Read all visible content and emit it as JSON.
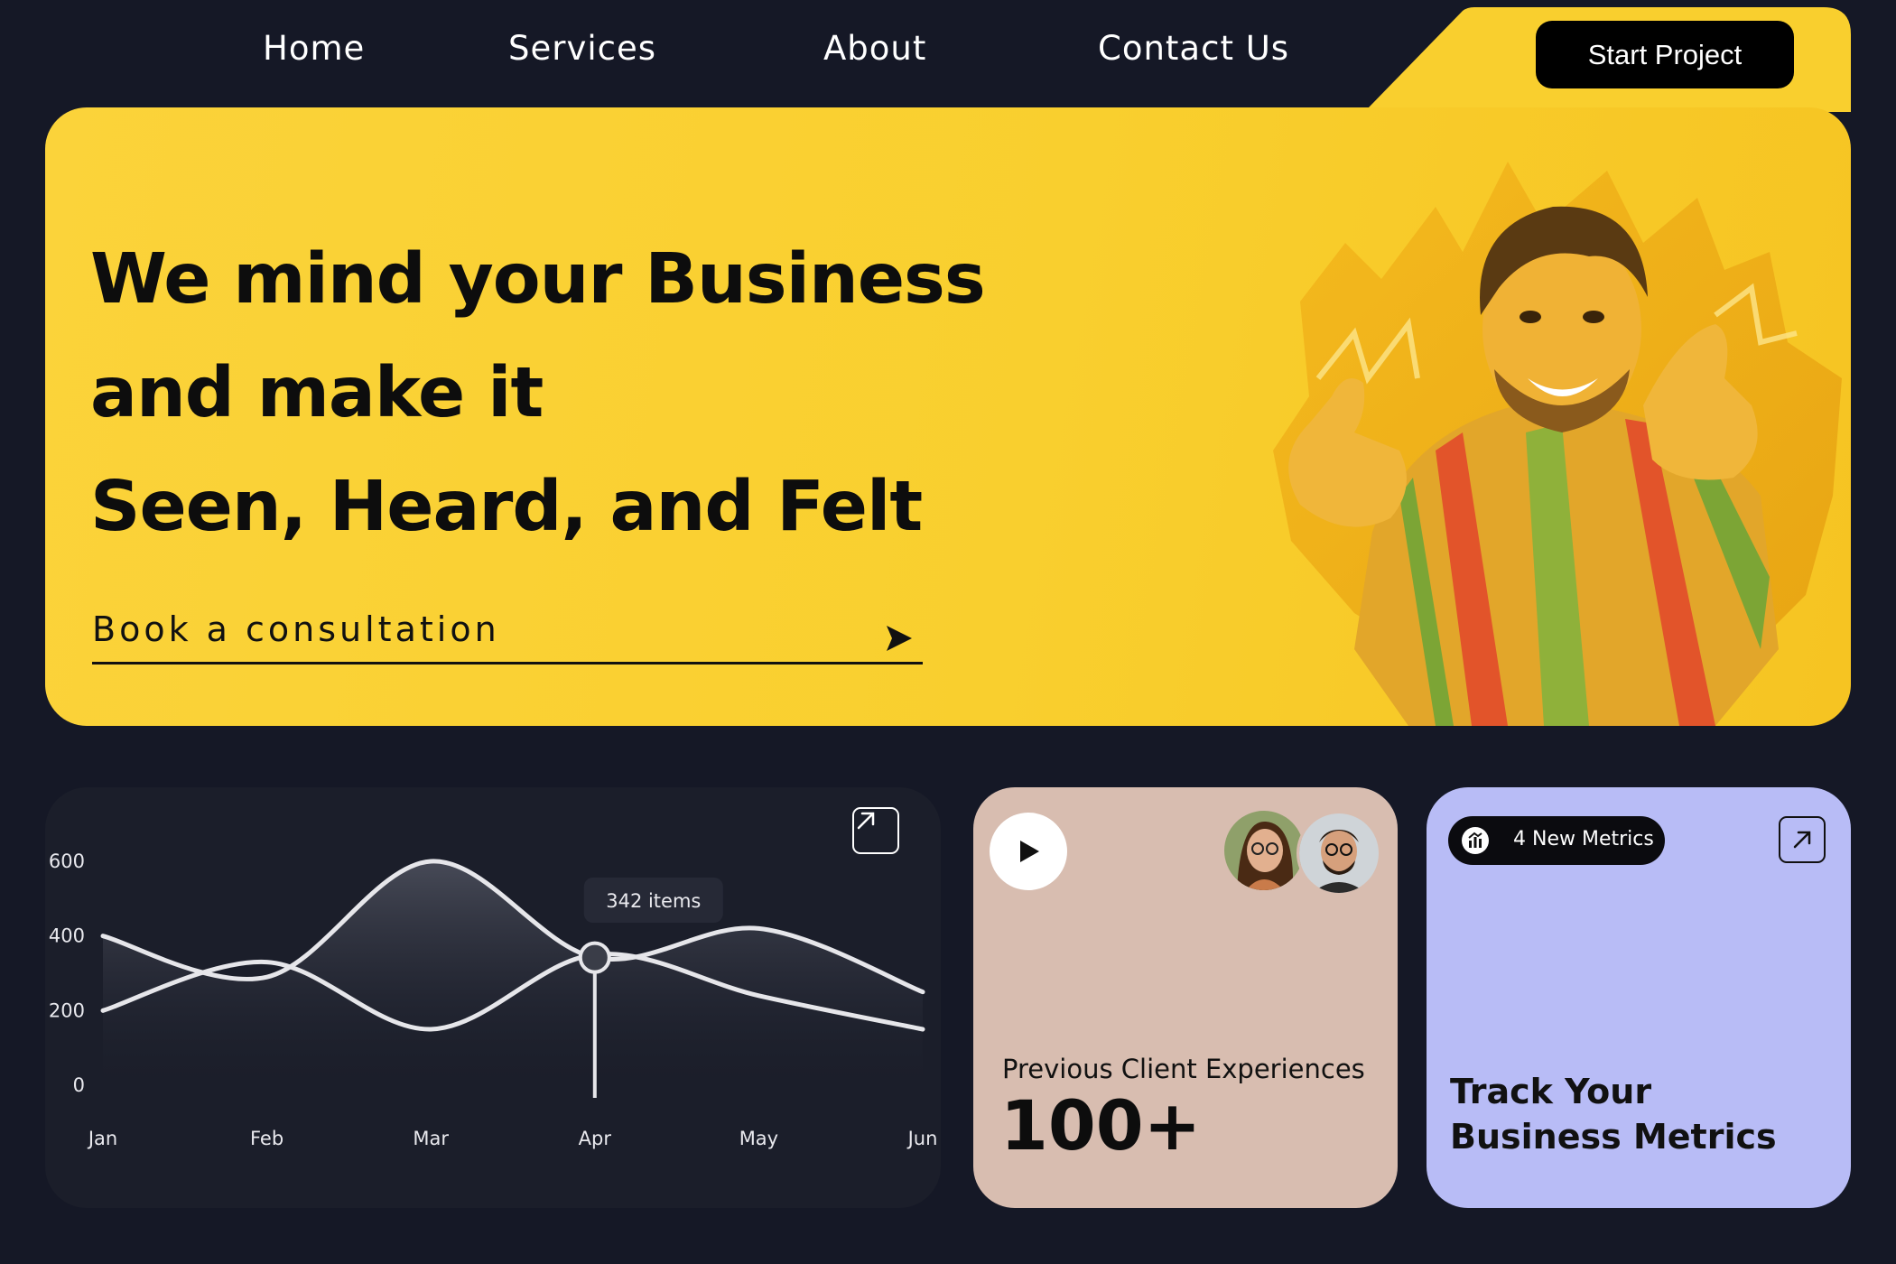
{
  "nav": {
    "links": [
      "Home",
      "Services",
      "About",
      "Contact Us"
    ],
    "cta_label": "Start Project"
  },
  "hero": {
    "title_lines": [
      "We mind your Business",
      "and make it",
      "Seen, Heard, and Felt"
    ],
    "cta_label": "Book a consultation"
  },
  "chart": {
    "tooltip": "342 items"
  },
  "chart_data": {
    "type": "line",
    "x": [
      "Jan",
      "Feb",
      "Mar",
      "Apr",
      "May",
      "Jun"
    ],
    "ylim": [
      0,
      600
    ],
    "yticks": [
      0,
      200,
      400,
      600
    ],
    "series": [
      {
        "values": [
          400,
          290,
          600,
          342,
          420,
          250
        ]
      },
      {
        "values": [
          200,
          330,
          150,
          350,
          240,
          150
        ]
      }
    ],
    "highlight": {
      "x": "Apr",
      "value": 342,
      "label": "342 items"
    },
    "grid": false
  },
  "client_card": {
    "label": "Previous Client Experiences",
    "count": "100+"
  },
  "metrics_card": {
    "badge": "4 New Metrics",
    "title": "Track Your Business Metrics"
  },
  "colors": {
    "background": "#151826",
    "hero": "#f9cf2e",
    "chart_card": "#1b1e2a",
    "client_card": "#d8bdb0",
    "metrics_card": "#b8bcf6"
  }
}
